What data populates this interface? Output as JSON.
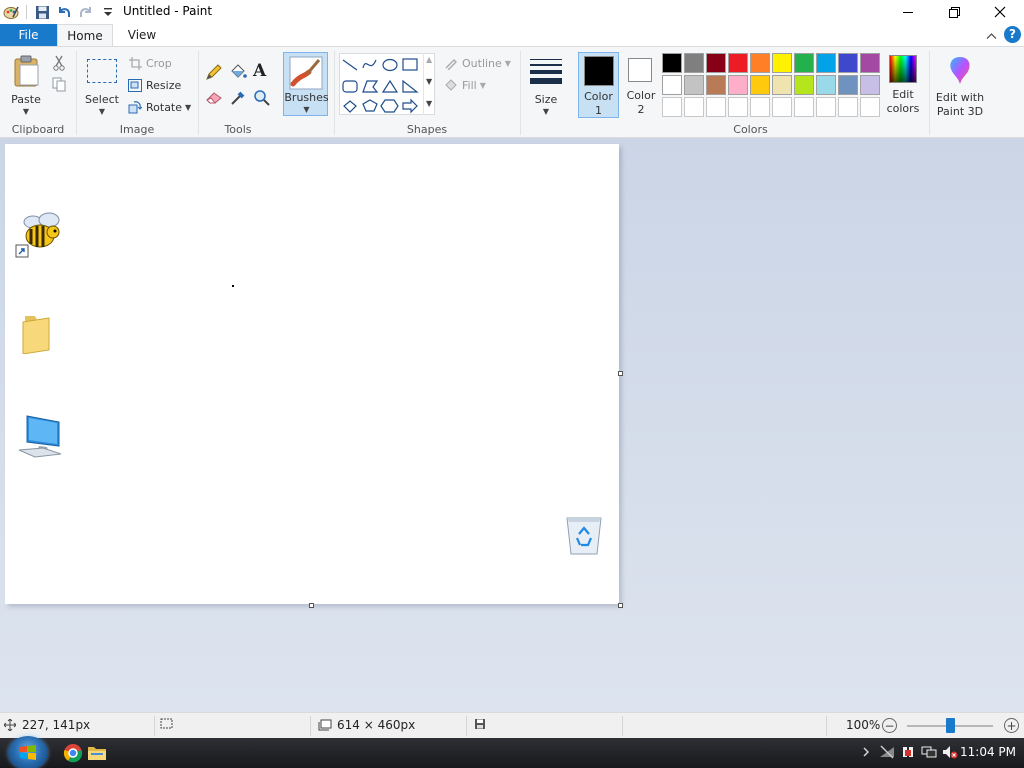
{
  "window": {
    "title": "Untitled - Paint"
  },
  "tabs": [
    {
      "label": "File"
    },
    {
      "label": "Home"
    },
    {
      "label": "View"
    }
  ],
  "ribbon": {
    "clipboard": {
      "group_label": "Clipboard",
      "paste_label": "Paste"
    },
    "image": {
      "group_label": "Image",
      "select_label": "Select",
      "crop_label": "Crop",
      "resize_label": "Resize",
      "rotate_label": "Rotate"
    },
    "tools": {
      "group_label": "Tools"
    },
    "brushes": {
      "label": "Brushes"
    },
    "shapes": {
      "group_label": "Shapes",
      "outline_label": "Outline",
      "fill_label": "Fill"
    },
    "size": {
      "label": "Size"
    },
    "colors": {
      "group_label": "Colors",
      "color1_label": "Color",
      "color1_num": "1",
      "color2_label": "Color",
      "color2_num": "2",
      "color1_value": "#000000",
      "color2_value": "#ffffff",
      "edit_colors_line1": "Edit",
      "edit_colors_line2": "colors",
      "paint3d_line1": "Edit with",
      "paint3d_line2": "Paint 3D",
      "palette_row1": [
        "#000000",
        "#7f7f7f",
        "#880015",
        "#ed1c24",
        "#ff7f27",
        "#fff200",
        "#22b14c",
        "#00a2e8",
        "#3f48cc",
        "#a349a4"
      ],
      "palette_row2": [
        "#ffffff",
        "#c3c3c3",
        "#b97a57",
        "#ffaec9",
        "#ffc90e",
        "#efe4b0",
        "#b5e61d",
        "#99d9ea",
        "#7092be",
        "#c8bfe7"
      ],
      "palette_row3_empty_count": 10
    }
  },
  "status": {
    "cursor_pos": "227, 141px",
    "canvas_size": "614 × 460px",
    "zoom": "100%",
    "zoom_level_percent": 100
  },
  "taskbar": {
    "clock": "11:04 PM",
    "apps": [
      "chrome-icon",
      "file-explorer-icon"
    ]
  },
  "desktop_icons": [
    "bee-shortcut-icon",
    "folder-icon",
    "computer-icon",
    "recycle-bin-icon"
  ]
}
